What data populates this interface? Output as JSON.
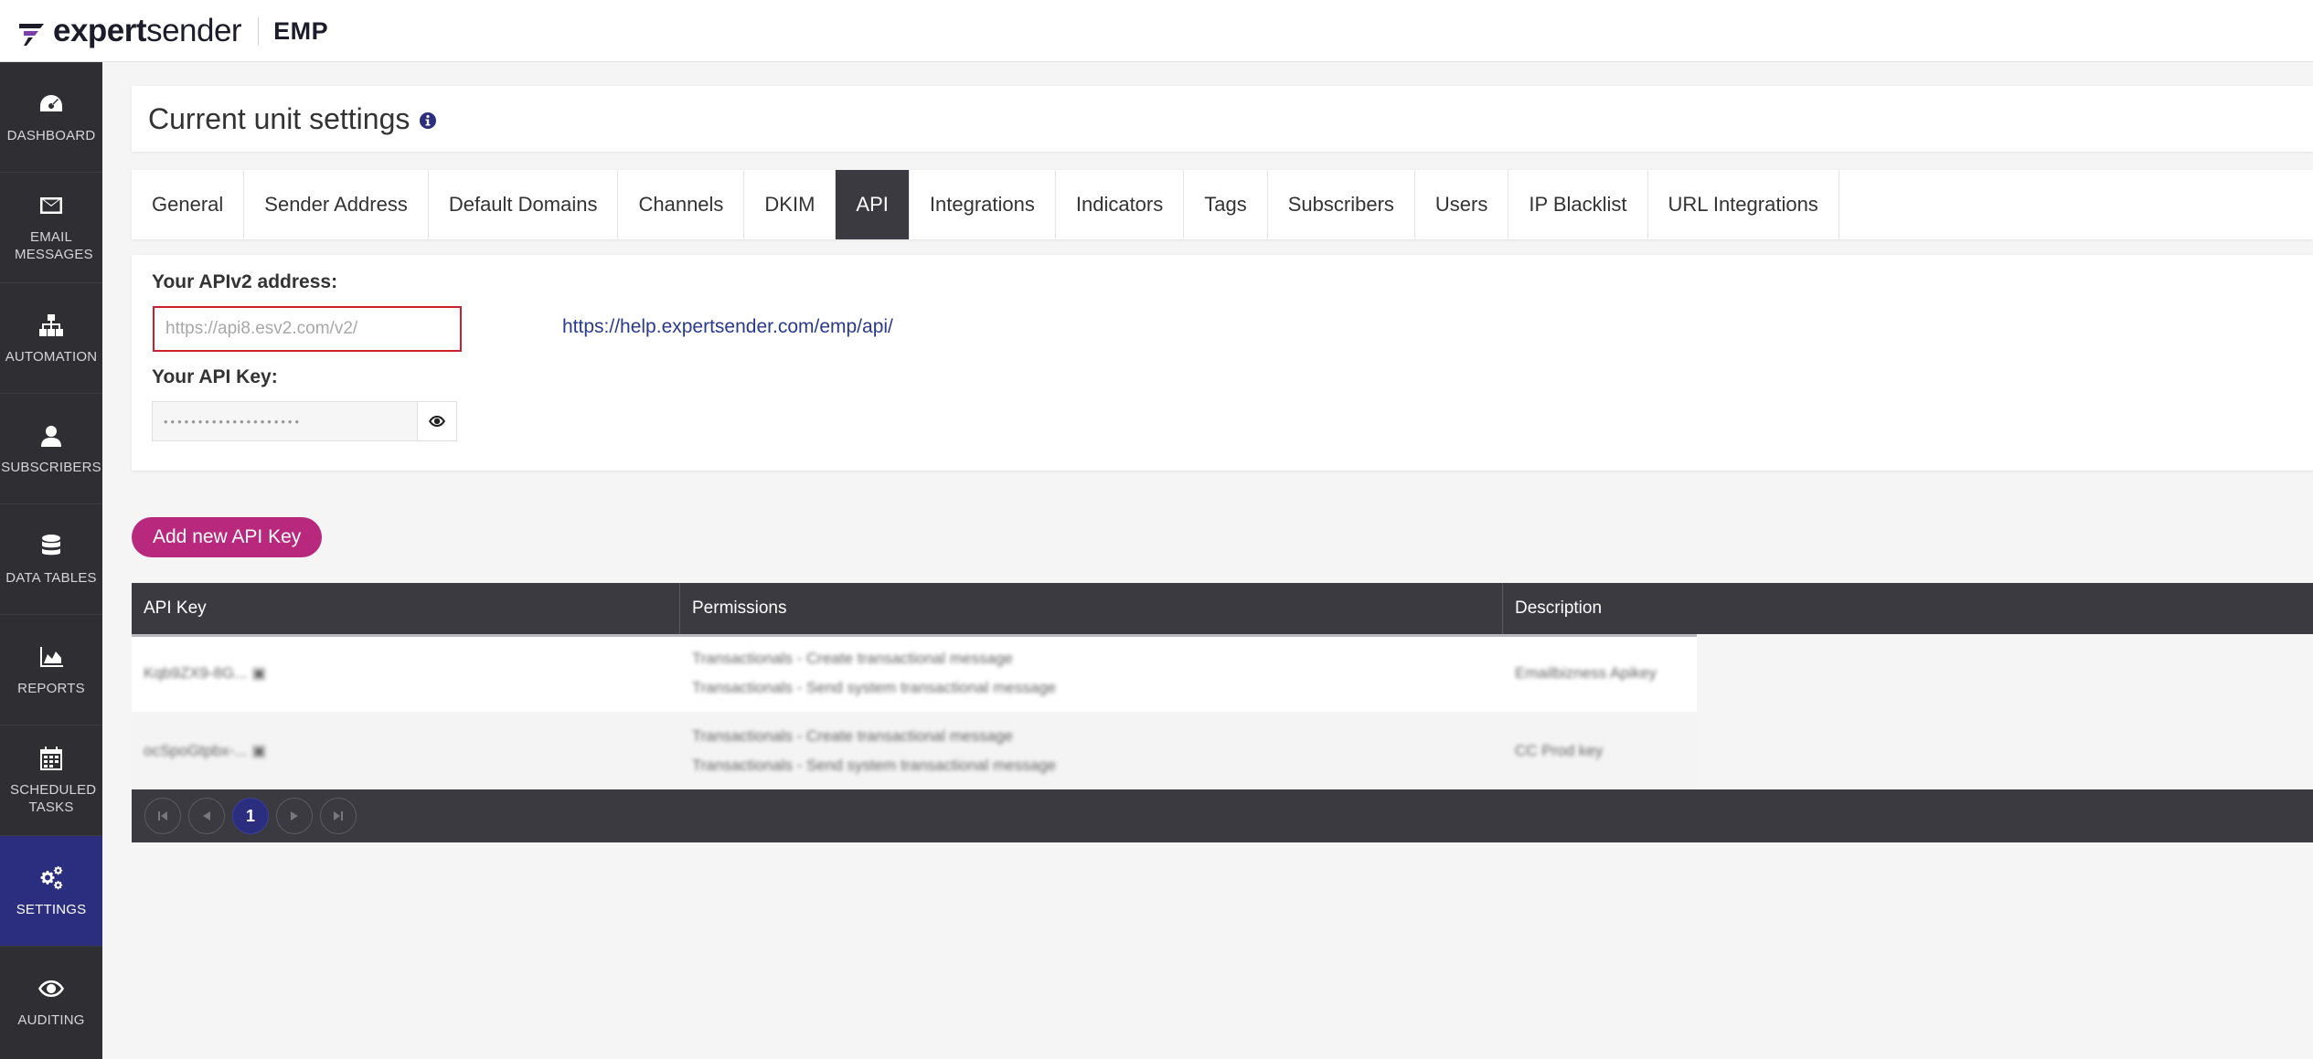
{
  "header": {
    "logo_bold": "expert",
    "logo_light": "sender",
    "app": "EMP"
  },
  "sidebar": {
    "items": [
      {
        "label": "DASHBOARD",
        "icon": "dashboard-icon"
      },
      {
        "label": "EMAIL MESSAGES",
        "icon": "envelope-icon"
      },
      {
        "label": "AUTOMATION",
        "icon": "sitemap-icon"
      },
      {
        "label": "SUBSCRIBERS",
        "icon": "user-icon"
      },
      {
        "label": "DATA TABLES",
        "icon": "database-icon"
      },
      {
        "label": "REPORTS",
        "icon": "area-chart-icon"
      },
      {
        "label": "SCHEDULED TASKS",
        "icon": "calendar-icon"
      },
      {
        "label": "SETTINGS",
        "icon": "gears-icon",
        "active": true
      },
      {
        "label": "AUDITING",
        "icon": "eye-icon"
      }
    ]
  },
  "page": {
    "title": "Current unit settings"
  },
  "tabs": [
    {
      "label": "General"
    },
    {
      "label": "Sender Address"
    },
    {
      "label": "Default Domains"
    },
    {
      "label": "Channels"
    },
    {
      "label": "DKIM"
    },
    {
      "label": "API",
      "active": true
    },
    {
      "label": "Integrations"
    },
    {
      "label": "Indicators"
    },
    {
      "label": "Tags"
    },
    {
      "label": "Subscribers"
    },
    {
      "label": "Users"
    },
    {
      "label": "IP Blacklist"
    },
    {
      "label": "URL Integrations"
    }
  ],
  "api": {
    "address_label": "Your APIv2 address:",
    "address_placeholder": "https://api8.esv2.com/v2/",
    "help_link": "https://help.expertsender.com/emp/api/",
    "key_label": "Your API Key:",
    "key_masked": "••••••••••••••••••••"
  },
  "add_button": "Add new API Key",
  "table": {
    "columns": [
      "API Key",
      "Permissions",
      "Description"
    ],
    "rows": [
      {
        "key": "Kqb9ZX9-8G... ▣",
        "permissions": [
          "Transactionals - Create transactional message",
          "Transactionals - Send system transactional message"
        ],
        "description": "Emailbizness Apikey"
      },
      {
        "key": "ocSpoGtpbx-... ▣",
        "permissions": [
          "Transactionals - Create transactional message",
          "Transactionals - Send system transactional message"
        ],
        "description": "CC Prod key"
      }
    ],
    "pager": {
      "current": "1"
    }
  },
  "colors": {
    "accent": "#b8287d",
    "sidebar_active": "#2b2e7e",
    "dark": "#3a3a40",
    "error_border": "#c7212e"
  }
}
